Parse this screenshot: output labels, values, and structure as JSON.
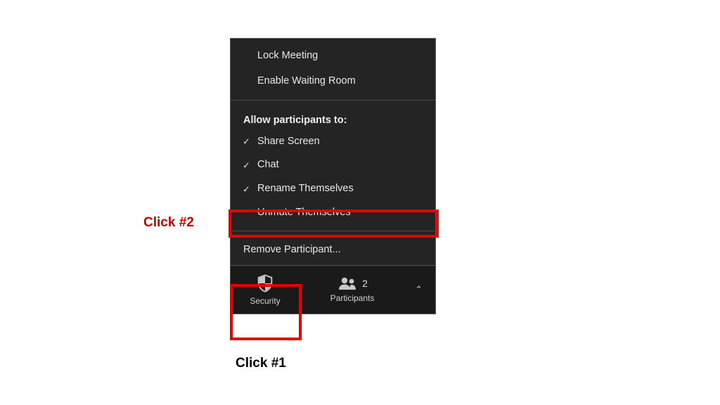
{
  "menu": {
    "lock_meeting": "Lock Meeting",
    "enable_waiting_room": "Enable Waiting Room",
    "allow_header": "Allow participants to:",
    "share_screen": "Share Screen",
    "chat": "Chat",
    "rename_themselves": "Rename Themselves",
    "unmute_themselves": "Unmute Themselves",
    "remove_participant": "Remove Participant..."
  },
  "toolbar": {
    "security_label": "Security",
    "participants_label": "Participants",
    "participants_count": "2"
  },
  "annotations": {
    "click1": "Click #1",
    "click2": "Click #2"
  }
}
